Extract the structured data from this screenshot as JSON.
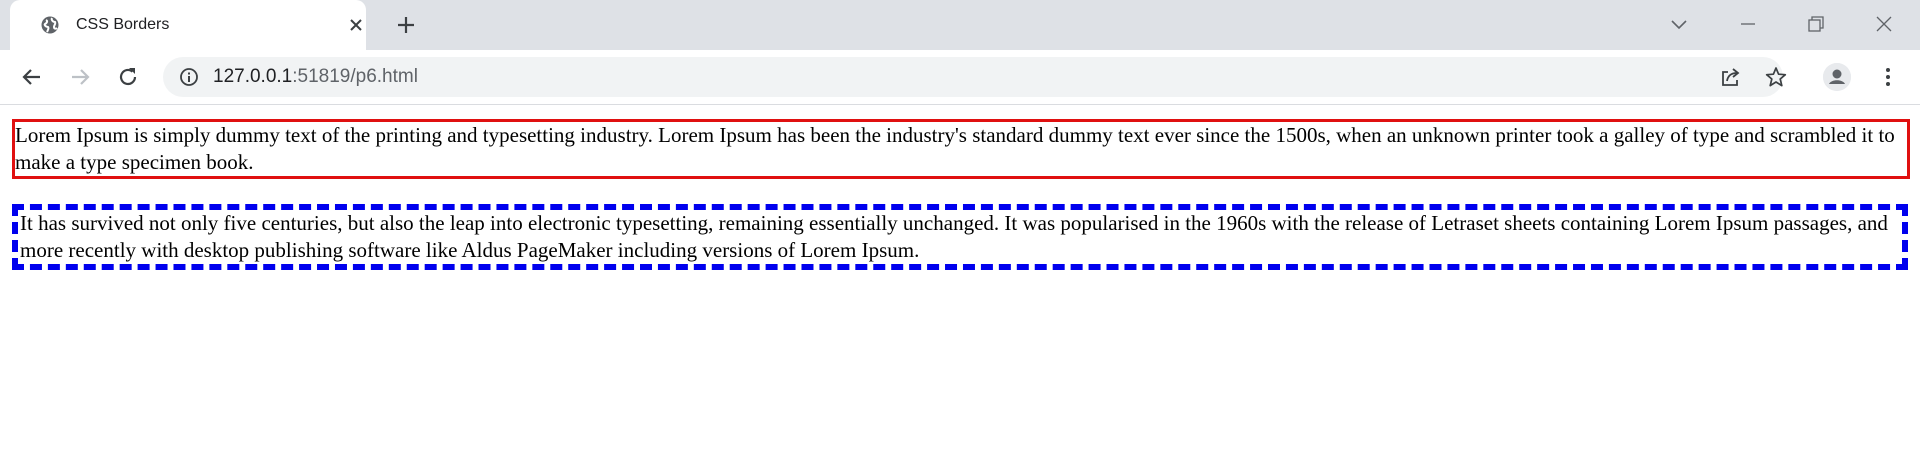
{
  "browser": {
    "tab": {
      "title": "CSS Borders",
      "favicon": "globe-icon",
      "close": "close-icon"
    },
    "new_tab": "plus-icon",
    "window_controls": [
      "tab-search-icon",
      "minimize-icon",
      "restore-icon",
      "close-window-icon"
    ],
    "toolbar": {
      "back": "arrow-left-icon",
      "forward": "arrow-right-icon",
      "reload": "reload-icon",
      "url_host": "127.0.0.1",
      "url_path": ":51819/p6.html",
      "site_info": "info-icon",
      "share": "share-icon",
      "bookmark": "star-icon",
      "profile": "profile-icon",
      "menu": "kebab-menu-icon"
    }
  },
  "page": {
    "paragraph_1": "Lorem Ipsum is simply dummy text of the printing and typesetting industry. Lorem Ipsum has been the industry's standard dummy text ever since the 1500s, when an unknown printer took a galley of type and scrambled it to make a type specimen book.",
    "paragraph_2": "It has survived not only five centuries, but also the leap into electronic typesetting, remaining essentially unchanged. It was popularised in the 1960s with the release of Letraset sheets containing Lorem Ipsum passages, and more recently with desktop publishing software like Aldus PageMaker including versions of Lorem Ipsum.",
    "colors": {
      "paragraph_1_border": "#e01010",
      "paragraph_2_border": "#0000ee"
    }
  }
}
